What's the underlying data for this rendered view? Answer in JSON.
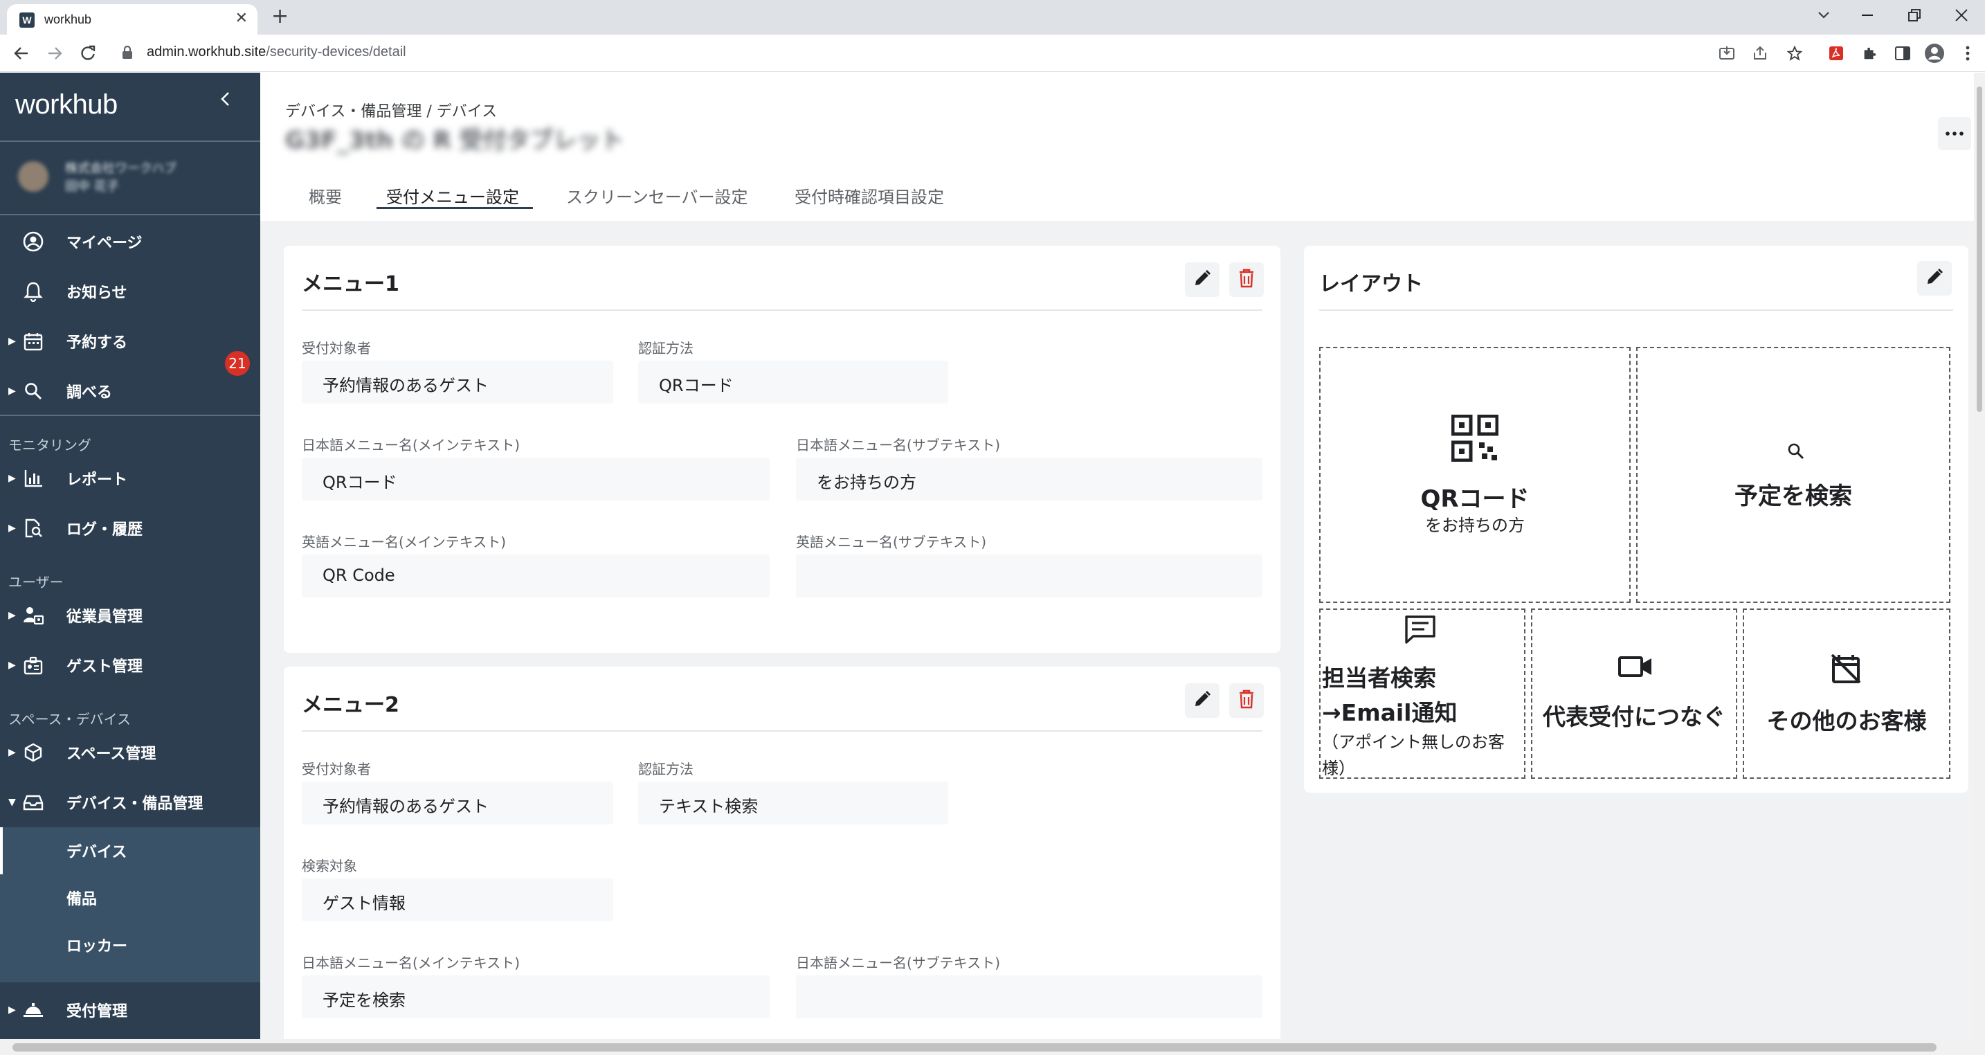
{
  "browser": {
    "tab_title": "workhub",
    "tab_favicon_letter": "W",
    "url_host": "admin.workhub.site",
    "url_path": "/security-devices/detail"
  },
  "sidebar": {
    "brand": "workhub",
    "user_line1": "株式会社ワークハブ",
    "user_line2": "田中 花子",
    "items": [
      {
        "label": "マイページ",
        "icon": "account-circle-icon"
      },
      {
        "label": "お知らせ",
        "icon": "bell-icon",
        "badge": "21"
      },
      {
        "label": "予約する",
        "icon": "calendar-icon"
      },
      {
        "label": "調べる",
        "icon": "search-icon"
      }
    ],
    "section_monitoring": "モニタリング",
    "monitoring_items": [
      {
        "label": "レポート",
        "icon": "bar-chart-icon"
      },
      {
        "label": "ログ・履歴",
        "icon": "log-search-icon"
      }
    ],
    "section_user": "ユーザー",
    "user_items": [
      {
        "label": "従業員管理",
        "icon": "employee-icon"
      },
      {
        "label": "ゲスト管理",
        "icon": "guest-badge-icon"
      }
    ],
    "section_space": "スペース・デバイス",
    "space_items": [
      {
        "label": "スペース管理",
        "icon": "cube-icon"
      },
      {
        "label": "デバイス・備品管理",
        "icon": "device-tray-icon"
      }
    ],
    "sub_items": [
      {
        "label": "デバイス"
      },
      {
        "label": "備品"
      },
      {
        "label": "ロッカー"
      }
    ],
    "reception": {
      "label": "受付管理",
      "icon": "bell-service-icon"
    }
  },
  "page": {
    "breadcrumb": "デバイス・備品管理 / デバイス",
    "device_title": "G3F_3th の R 受付タブレット",
    "more_label": "•••",
    "tabs": [
      {
        "label": "概要"
      },
      {
        "label": "受付メニュー設定",
        "active": true
      },
      {
        "label": "スクリーンセーバー設定"
      },
      {
        "label": "受付時確認項目設定"
      }
    ]
  },
  "menu1": {
    "title": "メニュー1",
    "target_label": "受付対象者",
    "target_value": "予約情報のあるゲスト",
    "auth_label": "認証方法",
    "auth_value": "QRコード",
    "ja_main_label": "日本語メニュー名(メインテキスト)",
    "ja_main_value": "QRコード",
    "ja_sub_label": "日本語メニュー名(サブテキスト)",
    "ja_sub_value": "をお持ちの方",
    "en_main_label": "英語メニュー名(メインテキスト)",
    "en_main_value": "QR Code",
    "en_sub_label": "英語メニュー名(サブテキスト)",
    "en_sub_value": ""
  },
  "menu2": {
    "title": "メニュー2",
    "target_label": "受付対象者",
    "target_value": "予約情報のあるゲスト",
    "auth_label": "認証方法",
    "auth_value": "テキスト検索",
    "search_label": "検索対象",
    "search_value": "ゲスト情報",
    "ja_main_label": "日本語メニュー名(メインテキスト)",
    "ja_main_value": "予定を検索",
    "ja_sub_label": "日本語メニュー名(サブテキスト)",
    "ja_sub_value": ""
  },
  "layout": {
    "title": "レイアウト",
    "cells": [
      {
        "main": "QRコード",
        "sub": "をお持ちの方",
        "icon": "qr-code-icon"
      },
      {
        "main": "予定を検索",
        "sub": "",
        "icon": "search-icon"
      },
      {
        "main": "担当者検索→Email通知",
        "sub": "（アポイント無しのお客様）",
        "icon": "message-icon"
      },
      {
        "main": "代表受付につなぐ",
        "sub": "",
        "icon": "video-camera-icon"
      },
      {
        "main": "その他のお客様",
        "sub": "",
        "icon": "calendar-off-icon"
      }
    ]
  },
  "colors": {
    "sidebar": "#2c3e50",
    "sidebar_sub": "#3a5268",
    "delete_red": "#d93025",
    "badge_red": "#d93025"
  }
}
